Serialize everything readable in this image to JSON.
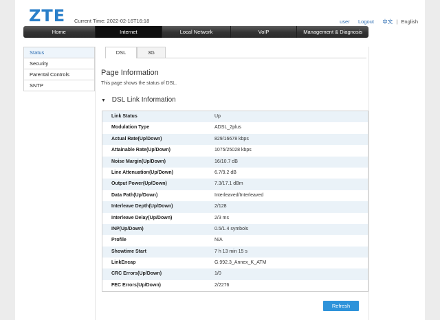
{
  "brand": {
    "logo": "ZTE"
  },
  "header": {
    "current_time_label": "Current Time:",
    "current_time": "2022-02-16T16:18",
    "links": {
      "user": "user",
      "logout": "Logout",
      "chinese": "中文",
      "separator": "|",
      "english": "English"
    }
  },
  "nav": {
    "items": [
      {
        "label": "Home"
      },
      {
        "label": "Internet"
      },
      {
        "label": "Local Network"
      },
      {
        "label": "VoIP"
      },
      {
        "label": "Management & Diagnosis"
      }
    ],
    "active": "Internet"
  },
  "sidebar": {
    "items": [
      {
        "label": "Status"
      },
      {
        "label": "Security"
      },
      {
        "label": "Parental Controls"
      },
      {
        "label": "SNTP"
      }
    ],
    "active": "Status"
  },
  "tabs": [
    {
      "label": "DSL"
    },
    {
      "label": "3G"
    }
  ],
  "main": {
    "title": "Page Information",
    "description": "This page shows the status of DSL.",
    "section_title": "DSL Link Information",
    "rows": [
      {
        "label": "Link Status",
        "value": "Up"
      },
      {
        "label": "Modulation Type",
        "value": "ADSL_2plus"
      },
      {
        "label": "Actual Rate(Up/Down)",
        "value": "829/16678 kbps"
      },
      {
        "label": "Attainable Rate(Up/Down)",
        "value": "1075/25028 kbps"
      },
      {
        "label": "Noise Margin(Up/Down)",
        "value": "16/10.7 dB"
      },
      {
        "label": "Line Attenuation(Up/Down)",
        "value": "6.7/9.2 dB"
      },
      {
        "label": "Output Power(Up/Down)",
        "value": "7.3/17.1 dBm"
      },
      {
        "label": "Data Path(Up/Down)",
        "value": "Interleaved/Interleaved"
      },
      {
        "label": "Interleave Depth(Up/Down)",
        "value": "2/128"
      },
      {
        "label": "Interleave Delay(Up/Down)",
        "value": "2/3 ms"
      },
      {
        "label": "INP(Up/Down)",
        "value": "0.5/1.4 symbols"
      },
      {
        "label": "Profile",
        "value": "N/A"
      },
      {
        "label": "Showtime Start",
        "value": "7 h 13 min 15 s"
      },
      {
        "label": "LinkEncap",
        "value": "G.992.3_Annex_K_ATM"
      },
      {
        "label": "CRC Errors(Up/Down)",
        "value": "1/0"
      },
      {
        "label": "FEC Errors(Up/Down)",
        "value": "2/2276"
      }
    ],
    "refresh_label": "Refresh"
  },
  "colors": {
    "brand_blue": "#2a7fc9",
    "link_blue": "#2f6fb3",
    "nav_dark": "#333333",
    "row_alt": "#eaf2f8",
    "button_blue": "#2e93da"
  }
}
